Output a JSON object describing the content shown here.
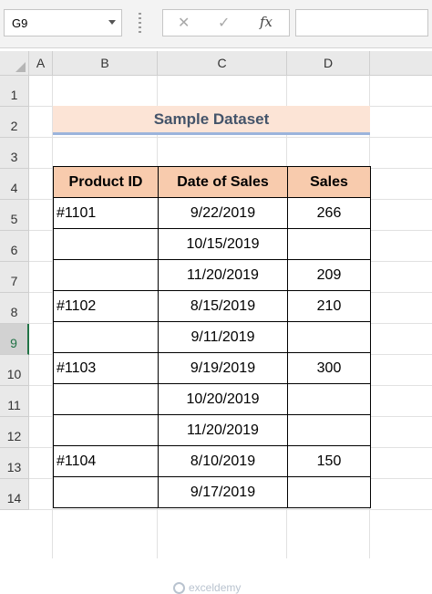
{
  "formula_bar": {
    "name_box": "G9",
    "cancel_icon": "✕",
    "enter_icon": "✓",
    "fx_label": "fx",
    "formula": ""
  },
  "columns": [
    "A",
    "B",
    "C",
    "D"
  ],
  "rows": [
    "1",
    "2",
    "3",
    "4",
    "5",
    "6",
    "7",
    "8",
    "9",
    "10",
    "11",
    "12",
    "13",
    "14"
  ],
  "selected_row": "9",
  "title": "Sample Dataset",
  "table": {
    "headers": [
      "Product ID",
      "Date of Sales",
      "Sales"
    ],
    "rows": [
      {
        "product_id": "#1101",
        "date": "9/22/2019",
        "sales": "266"
      },
      {
        "product_id": "",
        "date": "10/15/2019",
        "sales": ""
      },
      {
        "product_id": "",
        "date": "11/20/2019",
        "sales": "209"
      },
      {
        "product_id": "#1102",
        "date": "8/15/2019",
        "sales": "210"
      },
      {
        "product_id": "",
        "date": "9/11/2019",
        "sales": ""
      },
      {
        "product_id": "#1103",
        "date": "9/19/2019",
        "sales": "300"
      },
      {
        "product_id": "",
        "date": "10/20/2019",
        "sales": ""
      },
      {
        "product_id": "",
        "date": "11/20/2019",
        "sales": ""
      },
      {
        "product_id": "#1104",
        "date": "8/10/2019",
        "sales": "150"
      },
      {
        "product_id": "",
        "date": "9/17/2019",
        "sales": ""
      }
    ]
  },
  "watermark": "exceldemy",
  "colors": {
    "header_fill": "#f8cbad",
    "title_fill": "#fce4d6",
    "selection": "#217346"
  }
}
